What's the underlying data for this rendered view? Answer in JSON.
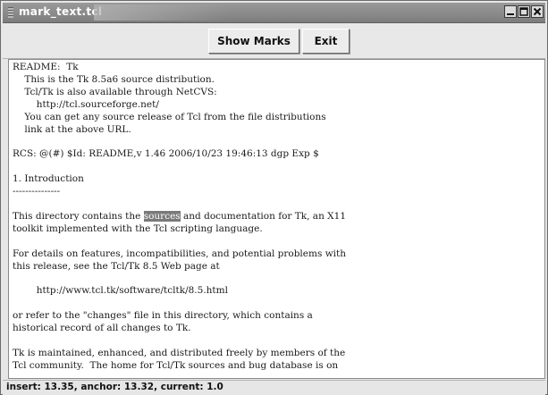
{
  "window": {
    "title": "mark_text.tcl",
    "controls": {
      "minimize_icon": "minimize-icon",
      "maximize_icon": "maximize-icon",
      "close_icon": "close-icon"
    }
  },
  "toolbar": {
    "show_marks_label": "Show Marks",
    "exit_label": "Exit"
  },
  "text": {
    "line_01": "README:  Tk",
    "line_02": "    This is the Tk 8.5a6 source distribution.",
    "line_03": "    Tcl/Tk is also available through NetCVS:",
    "line_04": "        http://tcl.sourceforge.net/",
    "line_05": "    You can get any source release of Tcl from the file distributions",
    "line_06": "    link at the above URL.",
    "line_07": "",
    "line_08": "RCS: @(#) $Id: README,v 1.46 2006/10/23 19:46:13 dgp Exp $",
    "line_09": "",
    "line_10": "1. Introduction",
    "line_11": "---------------",
    "line_12": "",
    "line_13_before": "This directory contains the ",
    "line_13_selected": "sources",
    "line_13_after": " and documentation for Tk, an X11",
    "line_14": "toolkit implemented with the Tcl scripting language.",
    "line_15": "",
    "line_16": "For details on features, incompatibilities, and potential problems with",
    "line_17": "this release, see the Tcl/Tk 8.5 Web page at",
    "line_18": "",
    "line_19": "        http://www.tcl.tk/software/tcltk/8.5.html",
    "line_20": "",
    "line_21": "or refer to the \"changes\" file in this directory, which contains a",
    "line_22": "historical record of all changes to Tk.",
    "line_23": "",
    "line_24": "Tk is maintained, enhanced, and distributed freely by members of the",
    "line_25": "Tcl community.  The home for Tcl/Tk sources and bug database is on"
  },
  "status": {
    "text": "insert: 13.35, anchor: 13.32, current: 1.0"
  },
  "colors": {
    "titlebar": "#8a8a8a",
    "selection": "#7a7a7a",
    "background": "#e6e6e6"
  }
}
